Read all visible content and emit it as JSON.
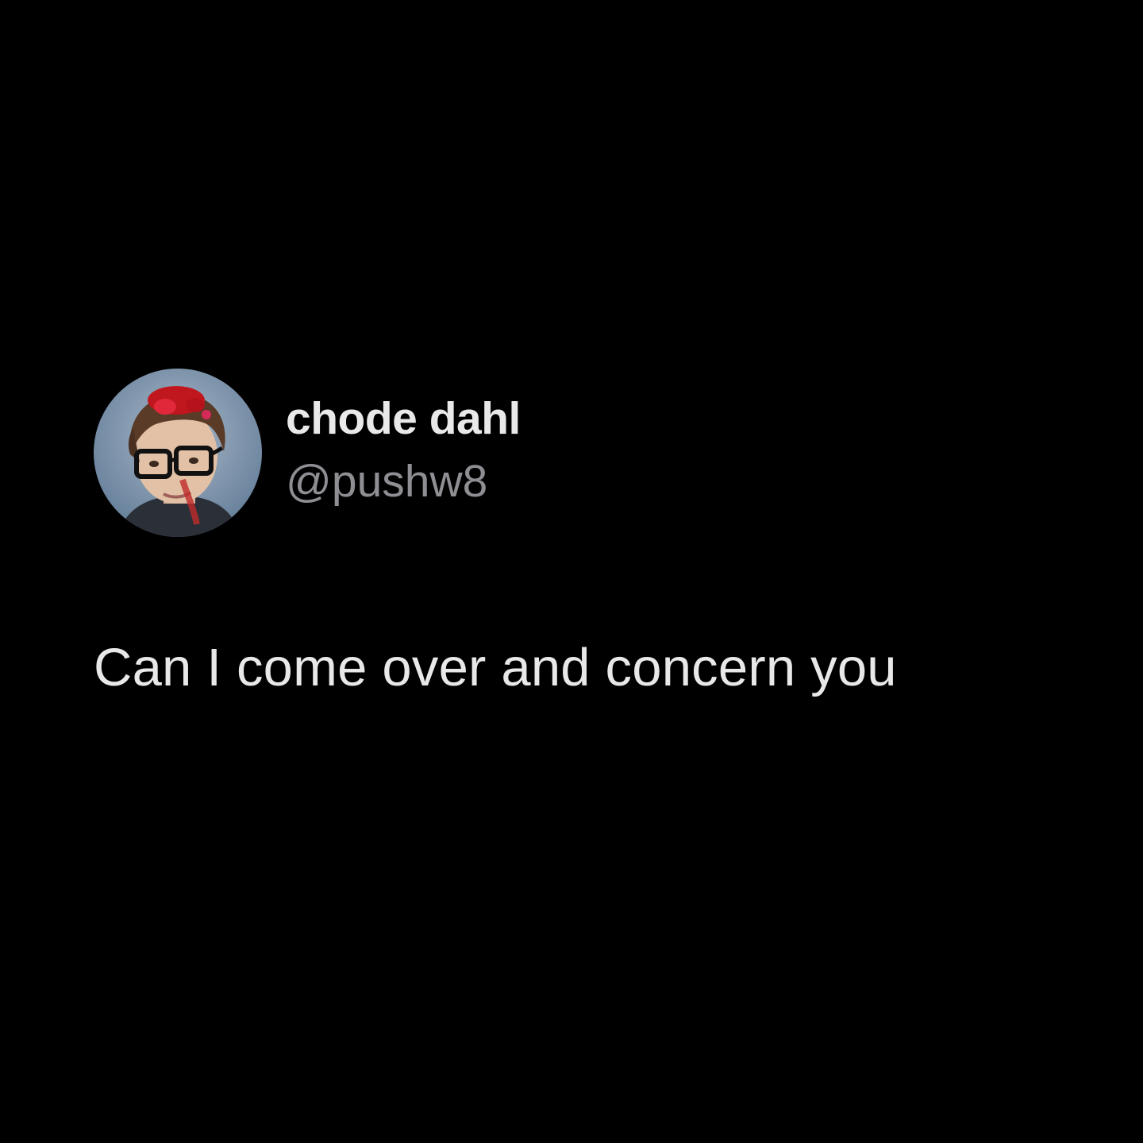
{
  "tweet": {
    "author": {
      "display_name": "chode dahl",
      "handle": "@pushw8",
      "avatar_icon": "profile-photo-icon"
    },
    "text": "Can I come over and concern you"
  },
  "colors": {
    "background": "#000000",
    "display_name": "#e9e9e9",
    "handle": "#8e8e93",
    "body_text": "#e8e8e8"
  }
}
